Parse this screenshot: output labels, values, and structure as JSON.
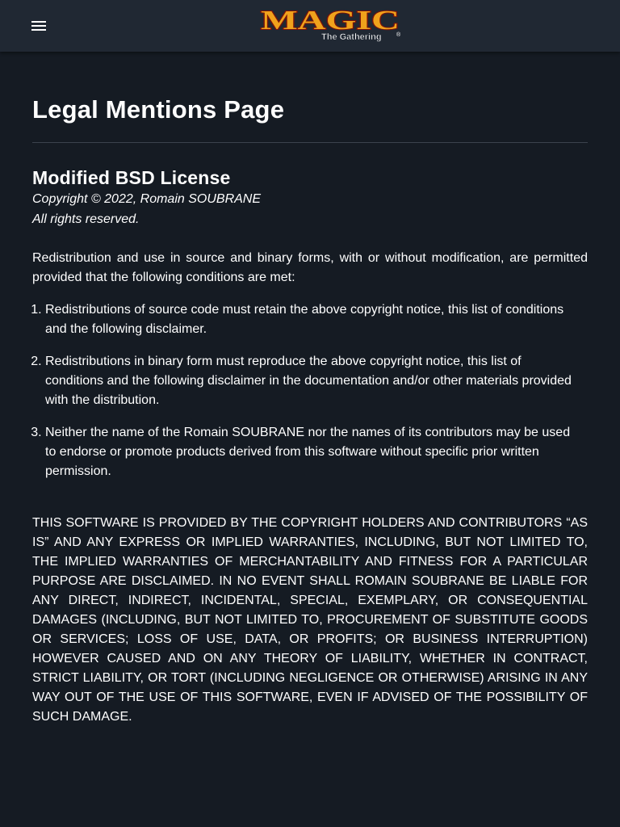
{
  "header": {
    "logo": {
      "title": "MAGIC",
      "subtitle": "The Gathering",
      "mark": "®",
      "colors": {
        "fill": "#f0a21c",
        "outline": "#7a1309",
        "subtitle": "#ffffff"
      }
    },
    "menu_icon": "hamburger-menu-icon"
  },
  "page": {
    "title": "Legal Mentions Page",
    "license_title": "Modified BSD License",
    "copyright_line": "Copyright © 2022, Romain SOUBRANE",
    "rights_line": "All rights reserved.",
    "intro": "Redistribution and use in source and binary forms, with or without modification, are permitted provided that the following conditions are met:",
    "conditions": [
      "Redistributions of source code must retain the above copyright notice, this list of conditions and the following disclaimer.",
      "Redistributions in binary form must reproduce the above copyright notice, this list of conditions and the following disclaimer in the documentation and/or other materials provided with the distribution.",
      "Neither the name of the Romain SOUBRANE nor the names of its contributors may be used to endorse or promote products derived from this software without specific prior written permission."
    ],
    "disclaimer": "THIS SOFTWARE IS PROVIDED BY THE COPYRIGHT HOLDERS AND CONTRIBUTORS “AS IS” AND ANY EXPRESS OR IMPLIED WARRANTIES, INCLUDING, BUT NOT LIMITED TO, THE IMPLIED WARRANTIES OF MERCHANTABILITY AND FITNESS FOR A PARTICULAR PURPOSE ARE DISCLAIMED. IN NO EVENT SHALL ROMAIN SOUBRANE BE LIABLE FOR ANY DIRECT, INDIRECT, INCIDENTAL, SPECIAL, EXEMPLARY, OR CONSEQUENTIAL DAMAGES (INCLUDING, BUT NOT LIMITED TO, PROCUREMENT OF SUBSTITUTE GOODS OR SERVICES; LOSS OF USE, DATA, OR PROFITS; OR BUSINESS INTERRUPTION) HOWEVER CAUSED AND ON ANY THEORY OF LIABILITY, WHETHER IN CONTRACT, STRICT LIABILITY, OR TORT (INCLUDING NEGLIGENCE OR OTHERWISE) ARISING IN ANY WAY OUT OF THE USE OF THIS SOFTWARE, EVEN IF ADVISED OF THE POSSIBILITY OF SUCH DAMAGE."
  },
  "colors": {
    "background": "#151b23",
    "topbar": "#202833",
    "text": "#ffffff",
    "divider": "#3b434d"
  }
}
